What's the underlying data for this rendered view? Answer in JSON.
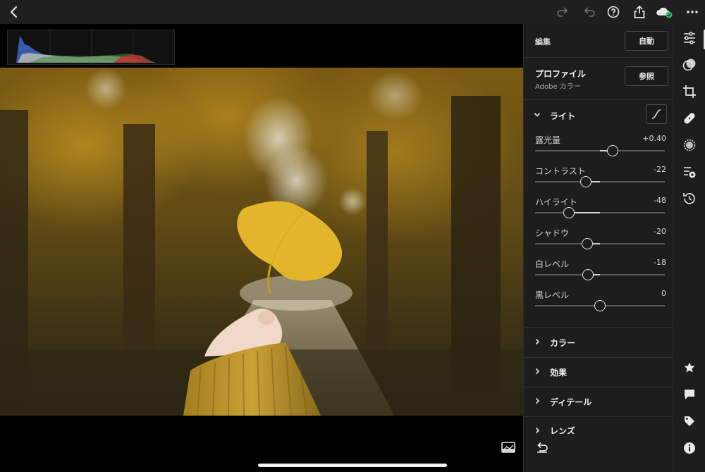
{
  "topbar": {
    "icons": [
      "back-chevron-icon",
      "redo-icon",
      "undo-icon",
      "help-icon",
      "share-icon",
      "cloud-sync-icon",
      "more-icon"
    ]
  },
  "panel": {
    "edit_label": "編集",
    "auto_button": "自動",
    "profile": {
      "title": "プロファイル",
      "value": "Adobe カラー",
      "browse_button": "参照"
    },
    "light_section": {
      "title": "ライト",
      "sliders": [
        {
          "name": "露光量",
          "value": "+0.40",
          "amount": 0.2
        },
        {
          "name": "コントラスト",
          "value": "-22",
          "amount": -0.22
        },
        {
          "name": "ハイライト",
          "value": "-48",
          "amount": -0.48
        },
        {
          "name": "シャドウ",
          "value": "-20",
          "amount": -0.2
        },
        {
          "name": "白レベル",
          "value": "-18",
          "amount": -0.18
        },
        {
          "name": "黒レベル",
          "value": "0",
          "amount": 0
        }
      ]
    },
    "sections": [
      {
        "title": "カラー"
      },
      {
        "title": "効果"
      },
      {
        "title": "ディテール"
      },
      {
        "title": "レンズ"
      }
    ]
  },
  "colors": {
    "panel_bg": "#1d1d1d",
    "topbar_bg": "#1f1f1f",
    "cloud_badge": "#2fbf71"
  }
}
